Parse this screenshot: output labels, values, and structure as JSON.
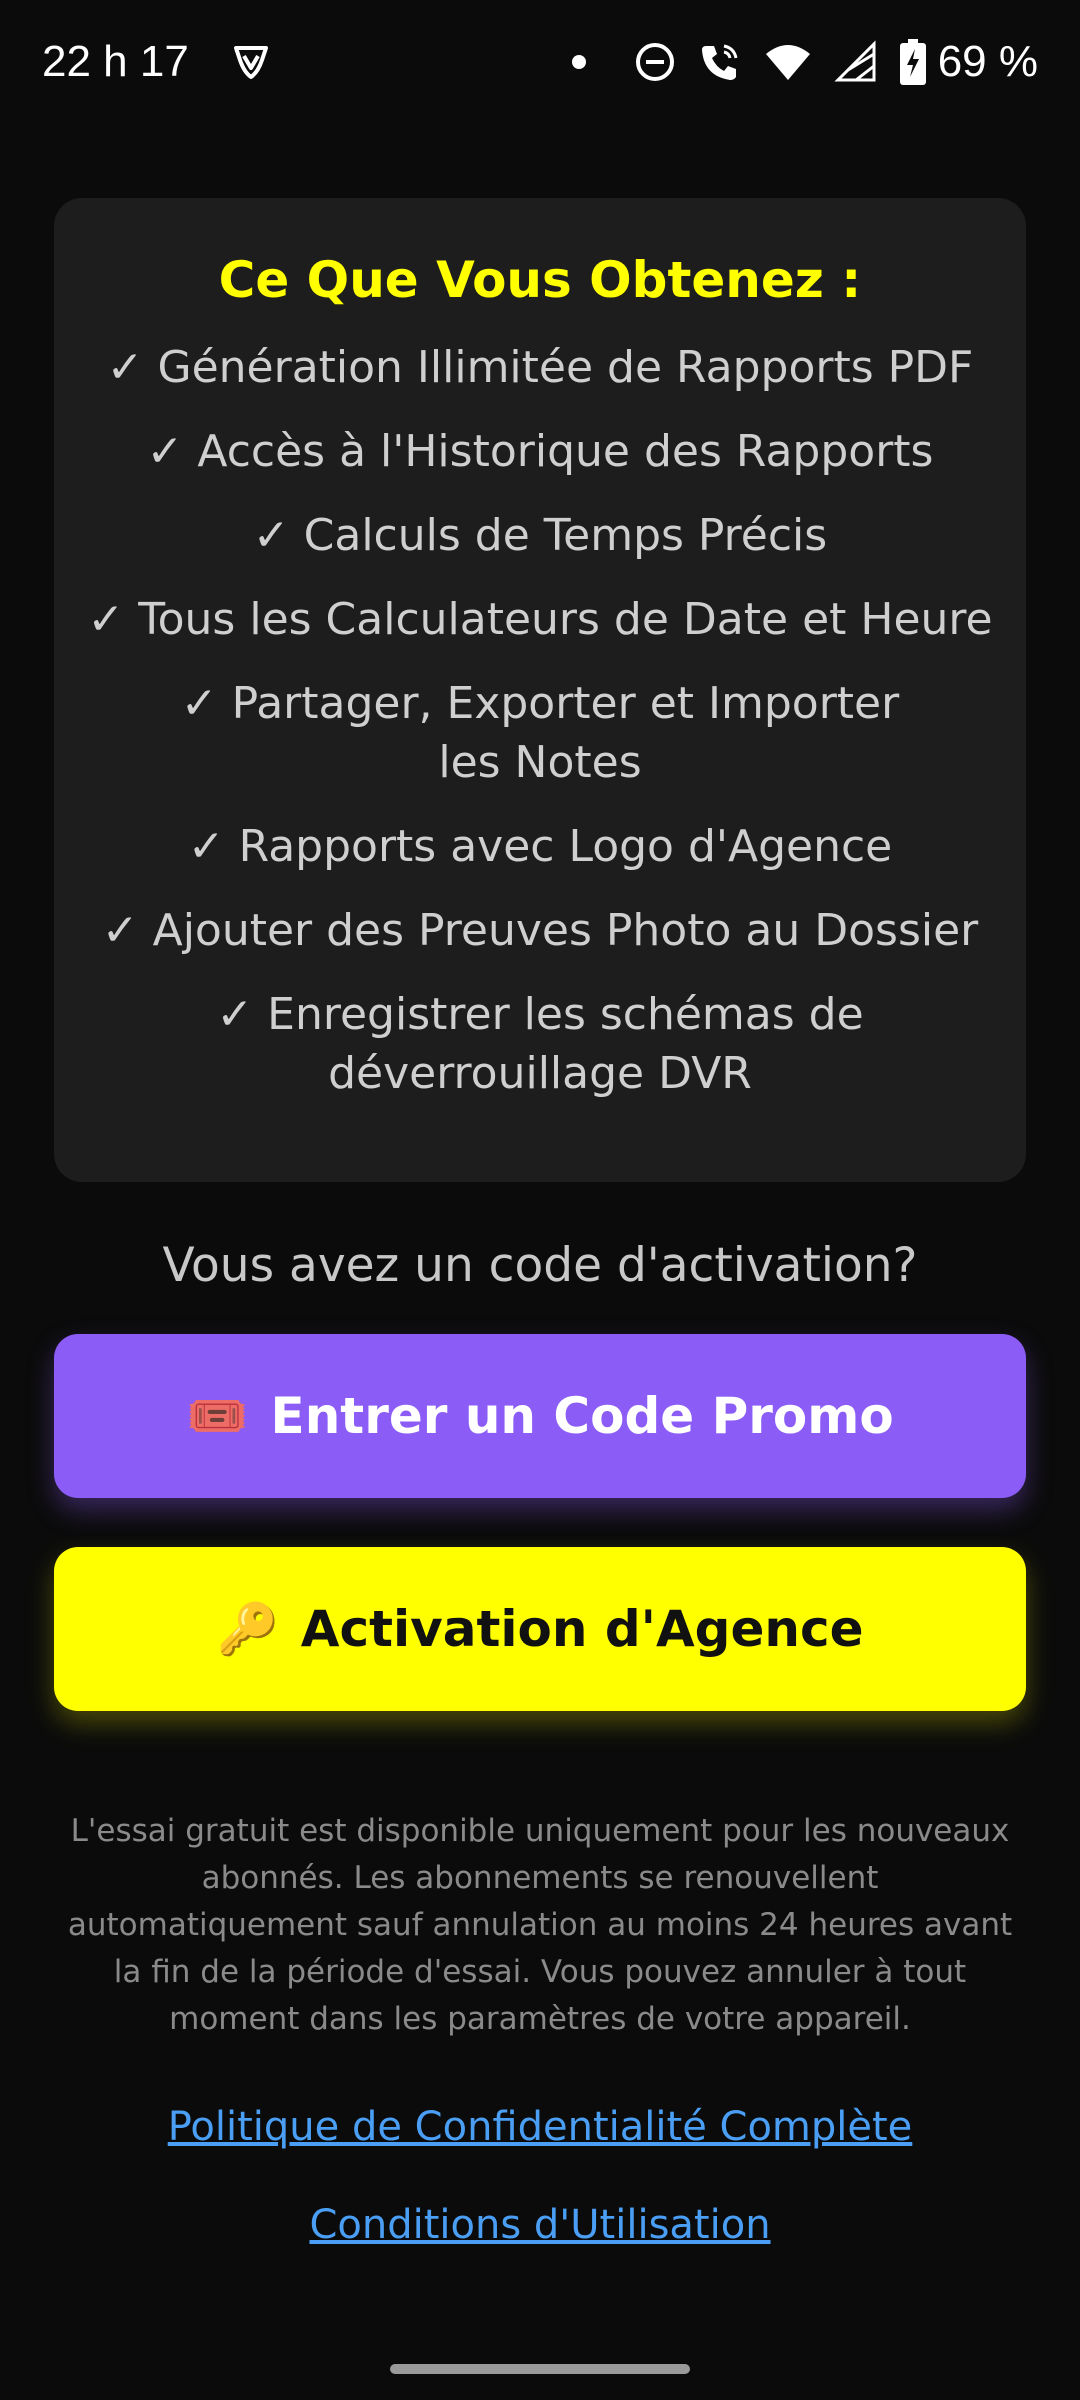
{
  "status_bar": {
    "time": "22 h 17",
    "battery": "69 %",
    "icons": [
      "vpn-shield-icon",
      "notification-dot-icon",
      "do-not-disturb-icon",
      "wifi-calling-icon",
      "wifi-icon",
      "cellular-signal-icon",
      "battery-charging-icon"
    ]
  },
  "features_card": {
    "title": "Ce Que Vous Obtenez :",
    "items": [
      "✓ Génération Illimitée de Rapports PDF",
      "✓ Accès à l'Historique des Rapports",
      "✓ Calculs de Temps Précis",
      "✓ Tous les Calculateurs de Date et Heure",
      "✓ Partager, Exporter et Importer les Notes",
      "✓ Rapports avec Logo d'Agence",
      "✓ Ajouter des Preuves Photo au Dossier",
      "✓ Enregistrer les schémas de déverrouillage DVR"
    ]
  },
  "activation_question": "Vous avez un code d'activation?",
  "buttons": {
    "promo": {
      "emoji": "🎟️",
      "label": "Entrer un Code Promo",
      "icon": "ticket-icon",
      "color": "#8b5cf6"
    },
    "agency": {
      "emoji": "🔑",
      "label": "Activation d'Agence",
      "icon": "key-icon",
      "color": "#ffff00"
    }
  },
  "disclaimer": "L'essai gratuit est disponible uniquement pour les nouveaux abonnés. Les abonnements se renouvellent automatiquement sauf annulation au moins 24 heures avant la fin de la période d'essai. Vous pouvez annuler à tout moment dans les paramètres de votre appareil.",
  "links": {
    "privacy": "Politique de Confidentialité Complète",
    "terms": "Conditions d'Utilisation"
  },
  "colors": {
    "accent_yellow": "#ffff00",
    "accent_purple": "#8b5cf6",
    "link_blue": "#4a9ff5",
    "card_bg": "#1d1d1d"
  }
}
